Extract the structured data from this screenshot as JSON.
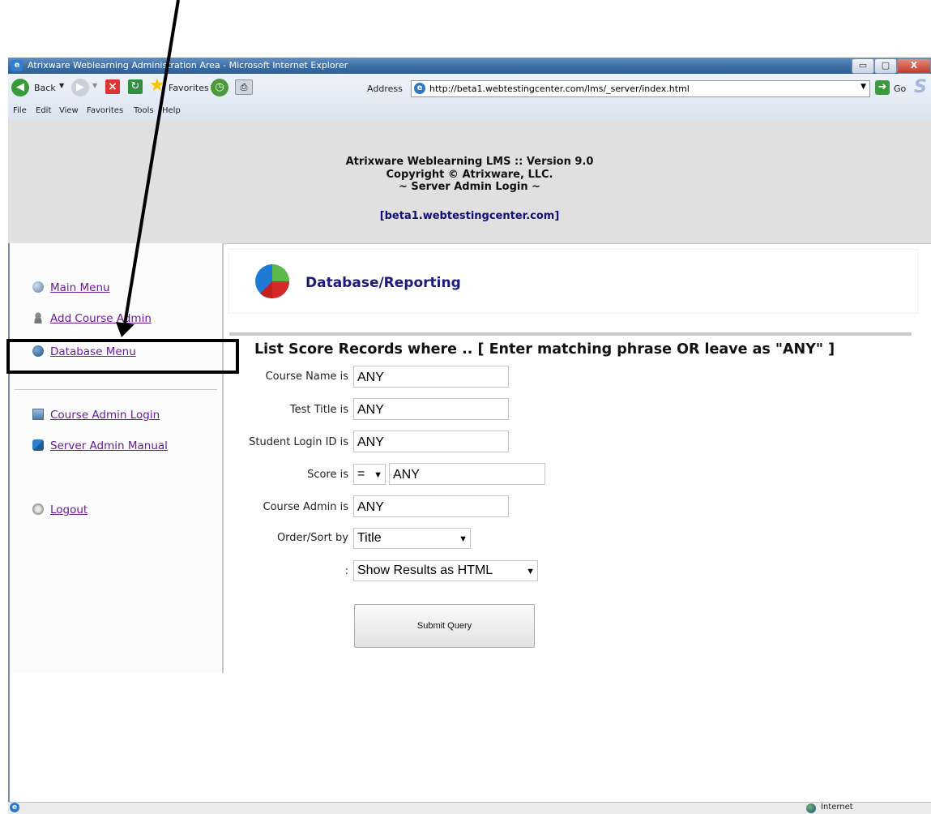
{
  "window": {
    "title": "Atrixware Weblearning Administration Area - Microsoft Internet Explorer",
    "minimize": "▭",
    "maximize": "▢",
    "close": "X"
  },
  "toolbar": {
    "back_label": "Back",
    "favorites_label": "Favorites",
    "address_label": "Address",
    "address_url": "http://beta1.webtestingcenter.com/lms/_server/index.html",
    "go_label": "Go"
  },
  "menu": [
    "File",
    "Edit",
    "View",
    "Favorites",
    "Tools",
    "Help"
  ],
  "header": {
    "line1": "Atrixware Weblearning LMS :: Version 9.0",
    "line2": "Copyright © Atrixware, LLC.",
    "line3": "~ Server Admin Login ~",
    "server": "[beta1.webtestingcenter.com]"
  },
  "sidebar": {
    "items": [
      {
        "label": "Main Menu",
        "icon": "globe-icon"
      },
      {
        "label": "Add Course Admin",
        "icon": "user-icon"
      },
      {
        "label": "Database Menu",
        "icon": "database-icon"
      },
      {
        "label": "Course Admin Login",
        "icon": "login-icon"
      },
      {
        "label": "Server Admin Manual",
        "icon": "manual-icon"
      },
      {
        "label": "Logout",
        "icon": "logout-icon"
      }
    ]
  },
  "main": {
    "banner_title": "Database/Reporting",
    "heading": "List Score Records where .. [ Enter matching phrase OR leave as \"ANY\" ]",
    "fields": {
      "course_name_label": "Course Name is",
      "course_name_value": "ANY",
      "test_title_label": "Test Title is",
      "test_title_value": "ANY",
      "student_login_label": "Student Login ID is",
      "student_login_value": "ANY",
      "score_label": "Score is",
      "score_operator": "=",
      "score_value": "ANY",
      "course_admin_label": "Course Admin is",
      "course_admin_value": "ANY",
      "order_label": "Order/Sort by",
      "order_value": "Title",
      "output_label": ":",
      "output_value": "Show Results as HTML"
    },
    "submit_label": "Submit Query"
  },
  "status": {
    "zone": "Internet"
  }
}
